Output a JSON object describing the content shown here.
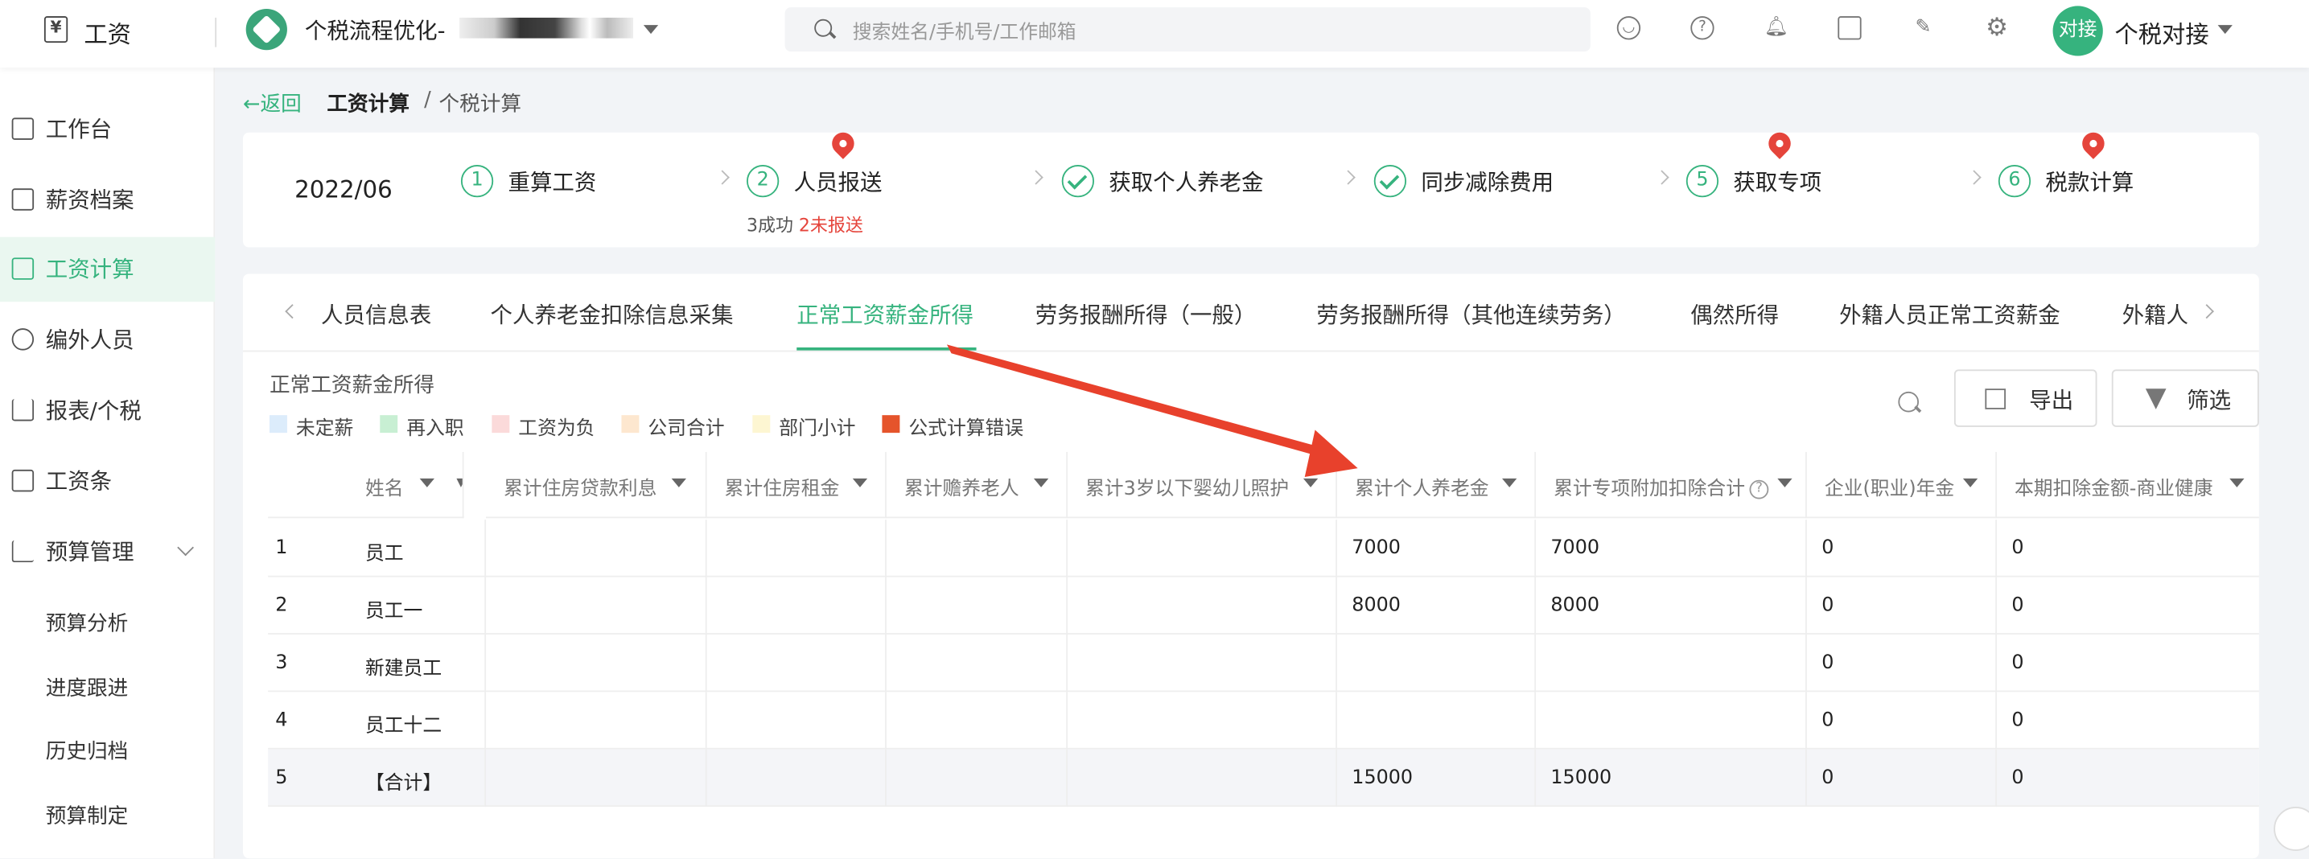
{
  "app": {
    "name": "工资",
    "icon": "yen-icon"
  },
  "org": {
    "name": "个税流程优化-"
  },
  "search": {
    "placeholder": "搜索姓名/手机号/工作邮箱"
  },
  "user": {
    "avatar_text": "对接",
    "name": "个税对接"
  },
  "sidebar": {
    "items": [
      {
        "label": "工作台"
      },
      {
        "label": "薪资档案"
      },
      {
        "label": "工资计算"
      },
      {
        "label": "编外人员"
      },
      {
        "label": "报表/个税"
      },
      {
        "label": "工资条"
      },
      {
        "label": "预算管理"
      }
    ],
    "subitems": [
      {
        "label": "预算分析"
      },
      {
        "label": "进度跟进"
      },
      {
        "label": "历史归档"
      },
      {
        "label": "预算制定"
      }
    ]
  },
  "breadcrumb": {
    "back": "←返回",
    "main": "工资计算",
    "sep": "/",
    "sub": "个税计算"
  },
  "period": "2022/06",
  "steps": [
    {
      "num": "1",
      "label": "重算工资"
    },
    {
      "num": "2",
      "label": "人员报送"
    },
    {
      "label": "获取个人养老金"
    },
    {
      "label": "同步减除费用"
    },
    {
      "num": "5",
      "label": "获取专项"
    },
    {
      "num": "6",
      "label": "税款计算"
    }
  ],
  "step2_status": {
    "success": "3成功",
    "pending": "2未报送"
  },
  "tabs": [
    "人员信息表",
    "个人养老金扣除信息采集",
    "正常工资薪金所得",
    "劳务报酬所得（一般）",
    "劳务报酬所得（其他连续劳务）",
    "偶然所得",
    "外籍人员正常工资薪金",
    "外籍人"
  ],
  "section_title": "正常工资薪金所得",
  "legend": [
    {
      "label": "未定薪",
      "color": "#dcecfb"
    },
    {
      "label": "再入职",
      "color": "#c8efd3"
    },
    {
      "label": "工资为负",
      "color": "#fbdada"
    },
    {
      "label": "公司合计",
      "color": "#fde7cf"
    },
    {
      "label": "部门小计",
      "color": "#fdf6d2"
    },
    {
      "label": "公式计算错误",
      "color": "#e5542b"
    }
  ],
  "actions": {
    "export": "导出",
    "filter": "筛选"
  },
  "table": {
    "headers": [
      "姓名",
      "累计住房贷款利息",
      "累计住房租金",
      "累计赡养老人",
      "累计3岁以下婴幼儿照护",
      "累计个人养老金",
      "累计专项附加扣除合计",
      "企业(职业)年金",
      "本期扣除金额-商业健康"
    ],
    "rows": [
      {
        "idx": "1",
        "name": "员工",
        "c1": "",
        "c2": "",
        "c3": "",
        "c4": "",
        "c5": "7000",
        "c6": "7000",
        "c7": "0",
        "c8": "0"
      },
      {
        "idx": "2",
        "name": "员工一",
        "c1": "",
        "c2": "",
        "c3": "",
        "c4": "",
        "c5": "8000",
        "c6": "8000",
        "c7": "0",
        "c8": "0"
      },
      {
        "idx": "3",
        "name": "新建员工",
        "c1": "",
        "c2": "",
        "c3": "",
        "c4": "",
        "c5": "",
        "c6": "",
        "c7": "0",
        "c8": "0"
      },
      {
        "idx": "4",
        "name": "员工十二",
        "c1": "",
        "c2": "",
        "c3": "",
        "c4": "",
        "c5": "",
        "c6": "",
        "c7": "0",
        "c8": "0"
      },
      {
        "idx": "5",
        "name": "【合计】",
        "c1": "",
        "c2": "",
        "c3": "",
        "c4": "",
        "c5": "15000",
        "c6": "15000",
        "c7": "0",
        "c8": "0"
      }
    ]
  },
  "colors": {
    "accent": "#36b37e",
    "alert": "#e5443b",
    "annotation_arrow": "#e8412c"
  }
}
